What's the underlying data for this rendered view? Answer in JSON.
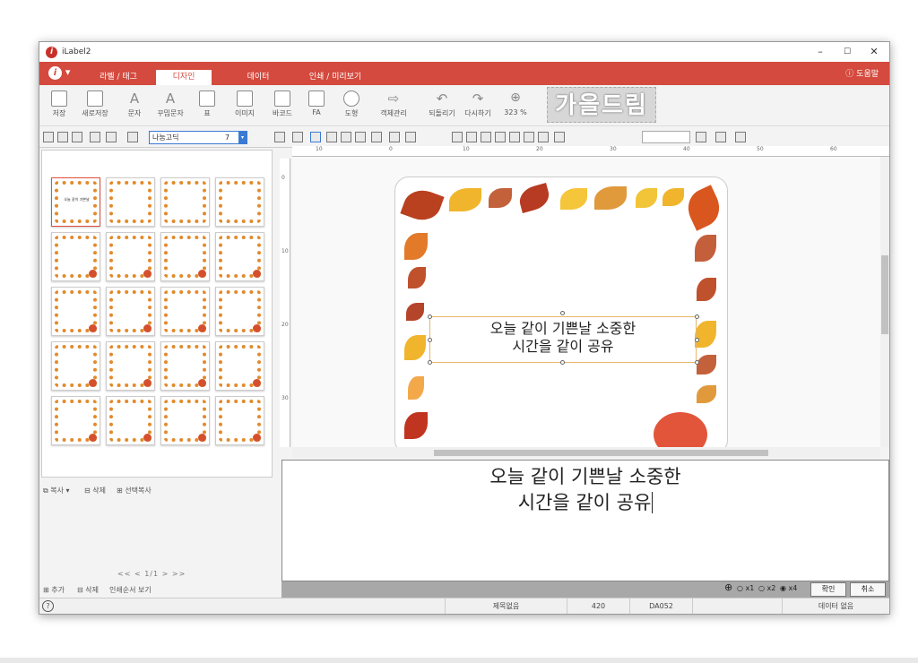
{
  "window": {
    "title": "iLabel2",
    "minimize": "–",
    "maximize": "☐",
    "close": "✕"
  },
  "ribbon": {
    "logo": "i",
    "tabs": [
      {
        "label": "라벨 / 태그"
      },
      {
        "label": "디자인"
      },
      {
        "label": "데이터"
      },
      {
        "label": "인쇄 / 미리보기"
      }
    ],
    "help": "ⓘ 도움말"
  },
  "toolbar": {
    "buttons": [
      {
        "label": "저장"
      },
      {
        "label": "새로저장"
      },
      {
        "label": "문자"
      },
      {
        "label": "꾸밈문자"
      },
      {
        "label": "표"
      },
      {
        "label": "이미지"
      },
      {
        "label": "바코드"
      },
      {
        "label": "FA"
      },
      {
        "label": "도형"
      },
      {
        "label": "객체관리"
      },
      {
        "label": "되돌리기"
      },
      {
        "label": "다시하기"
      },
      {
        "label": "323 %"
      }
    ],
    "banner": "가을드림"
  },
  "format": {
    "font": "나눔고딕",
    "size": "7"
  },
  "thumbnail_mini_text": "오늘 같이 기쁜날",
  "left_actions": {
    "copy": "복사",
    "delete": "삭제",
    "select_copy": "선택복사"
  },
  "pager": "<< < 1/1 > >>",
  "left_bottom": {
    "add": "추가",
    "delete": "삭제",
    "print_order": "인쇄순서 보기"
  },
  "ruler": {
    "h": [
      "10",
      "0",
      "10",
      "20",
      "30",
      "40",
      "50",
      "60"
    ],
    "v": [
      "0",
      "10",
      "20",
      "30"
    ]
  },
  "label": {
    "line1": "오늘 같이 기쁜날 소중한",
    "line2": "시간을 같이 공유"
  },
  "editor": {
    "line1": "오늘 같이 기쁜날 소중한",
    "line2": "시간을 같이 공유"
  },
  "zoom": {
    "x1": "x1",
    "x2": "x2",
    "x4": "x4",
    "ok": "확인",
    "cancel": "취소"
  },
  "status": {
    "help": "?",
    "title": "제목없음",
    "num": "420",
    "code": "DA052",
    "data": "데이터 없음"
  }
}
